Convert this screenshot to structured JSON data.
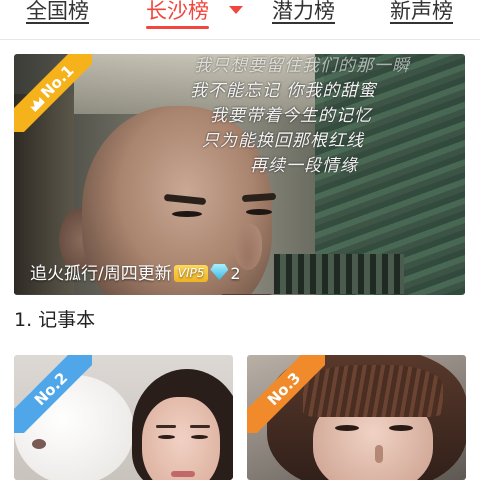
{
  "tabs": [
    {
      "label": "全国榜",
      "active": false
    },
    {
      "label": "长沙榜",
      "active": true
    },
    {
      "label": "潜力榜",
      "active": false
    },
    {
      "label": "新声榜",
      "active": false
    }
  ],
  "accent_color": "#f2453d",
  "featured": {
    "rank_badge": "No.1",
    "poem_lines": [
      "我只想要留住我们的那一瞬",
      "我不能忘记 你我的甜蜜",
      "我要带着今生的记忆",
      "只为能换回那根红线",
      "再续一段情缘"
    ],
    "caption": "追火孤行/周四更新",
    "vip_label": "VIP5",
    "diamond_count": "2",
    "icons": [
      "crown-icon",
      "diamond-icon"
    ]
  },
  "rank_title": "1. 记事本",
  "cards": [
    {
      "rank_badge": "No.2"
    },
    {
      "rank_badge": "No.3"
    }
  ]
}
